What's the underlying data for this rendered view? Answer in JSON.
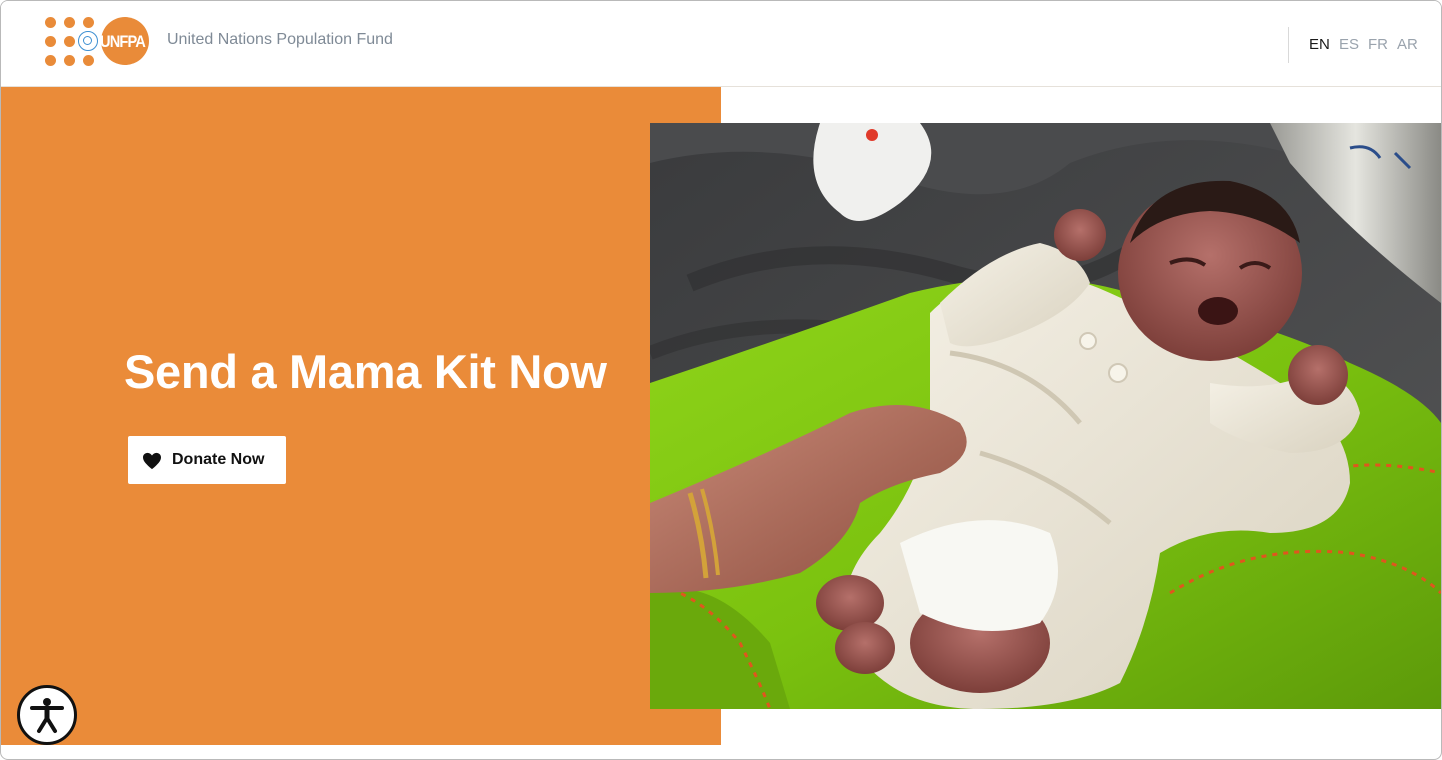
{
  "header": {
    "logo_text": "UNFPA",
    "org_name": "United Nations Population Fund",
    "languages": [
      {
        "label": "EN",
        "active": true
      },
      {
        "label": "ES",
        "active": false
      },
      {
        "label": "FR",
        "active": false
      },
      {
        "label": "AR",
        "active": false
      }
    ]
  },
  "hero": {
    "headline": "Send a Mama Kit Now",
    "donate_label": "Donate Now",
    "image_alt": "heart-icon",
    "image_subject": "newborn-baby-photo"
  },
  "accessibility": {
    "icon": "accessibility-icon"
  },
  "colors": {
    "brand_orange": "#ea8b39",
    "text_gray": "#7f8a96",
    "white": "#ffffff"
  }
}
